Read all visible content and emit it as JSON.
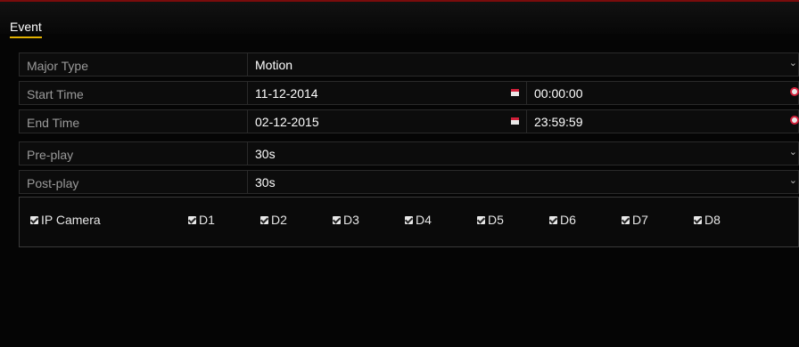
{
  "tab": {
    "label": "Event"
  },
  "major_type": {
    "label": "Major Type",
    "value": "Motion"
  },
  "start_time": {
    "label": "Start Time",
    "date": "11-12-2014",
    "time": "00:00:00"
  },
  "end_time": {
    "label": "End Time",
    "date": "02-12-2015",
    "time": "23:59:59"
  },
  "pre_play": {
    "label": "Pre-play",
    "value": "30s"
  },
  "post_play": {
    "label": "Post-play",
    "value": "30s"
  },
  "cameras": {
    "all_label": "IP Camera",
    "items": [
      "D1",
      "D2",
      "D3",
      "D4",
      "D5",
      "D6",
      "D7",
      "D8"
    ]
  },
  "icons": {
    "calendar": "calendar-icon",
    "clock": "clock-icon",
    "dropdown": "chevron-down-icon",
    "checkbox": "checked"
  },
  "colors": {
    "accent_tab": "#e0b000",
    "title_bar": "#7a0c0c",
    "icon_red": "#d1203a"
  }
}
